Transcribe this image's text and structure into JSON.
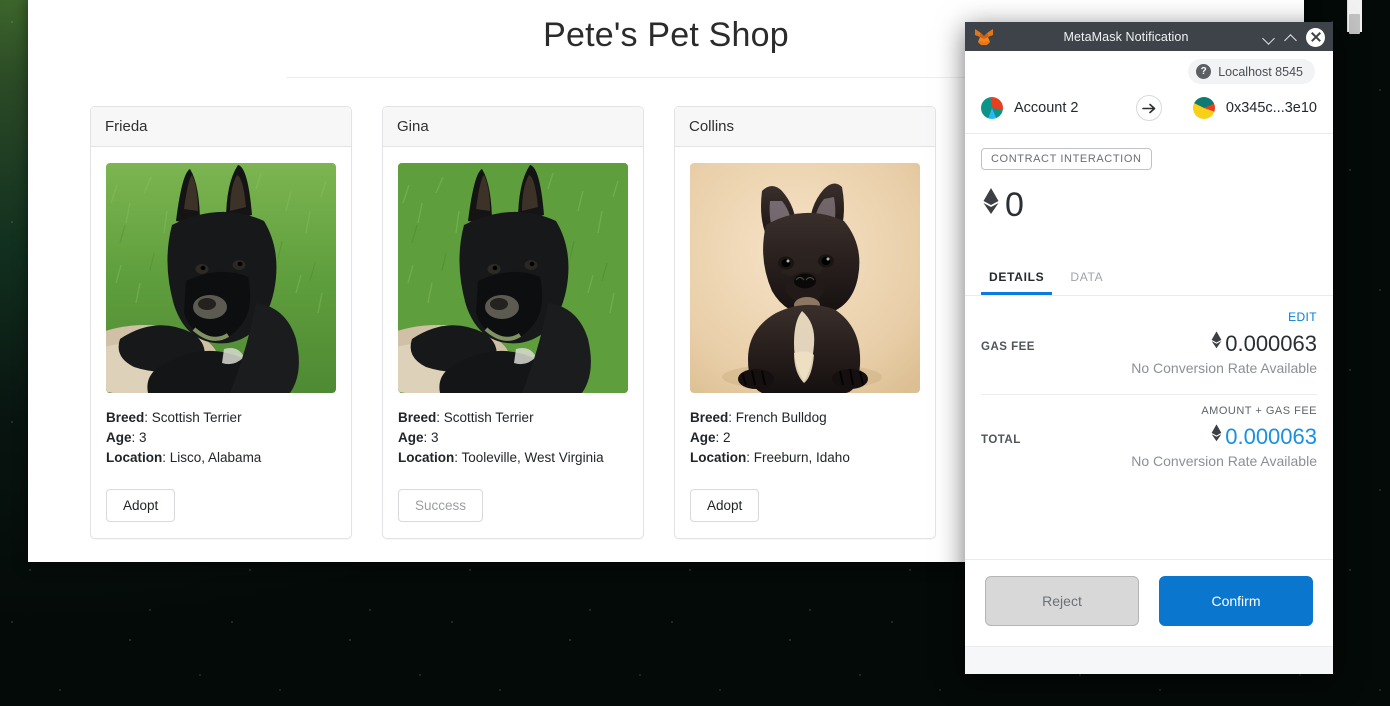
{
  "desktop": {
    "background_color": "#0a1b12"
  },
  "site": {
    "title": "Pete's Pet Shop",
    "pets": [
      {
        "name": "Frieda",
        "breed_label": "Breed",
        "breed": "Scottish Terrier",
        "age_label": "Age",
        "age": "3",
        "location_label": "Location",
        "location": "Lisco, Alabama",
        "button": "Adopt",
        "button_state": "enabled",
        "photo": "scottish-terrier-grass"
      },
      {
        "name": "Gina",
        "breed_label": "Breed",
        "breed": "Scottish Terrier",
        "age_label": "Age",
        "age": "3",
        "location_label": "Location",
        "location": "Tooleville, West Virginia",
        "button": "Success",
        "button_state": "disabled",
        "photo": "scottish-terrier-grass"
      },
      {
        "name": "Collins",
        "breed_label": "Breed",
        "breed": "French Bulldog",
        "age_label": "Age",
        "age": "2",
        "location_label": "Location",
        "location": "Freeburn, Idaho",
        "button": "Adopt",
        "button_state": "enabled",
        "photo": "french-bulldog-tan"
      }
    ]
  },
  "metamask": {
    "window_title": "MetaMask Notification",
    "network": "Localhost 8545",
    "from_account": "Account 2",
    "to_address": "0x345c...3e10",
    "tx_type_pill": "CONTRACT INTERACTION",
    "amount": "0",
    "eth_symbol": "♦",
    "tabs": [
      {
        "label": "DETAILS",
        "active": true
      },
      {
        "label": "DATA",
        "active": false
      }
    ],
    "edit_link": "EDIT",
    "gas_fee_label": "GAS FEE",
    "gas_fee_value": "0.000063",
    "gas_fee_conversion": "No Conversion Rate Available",
    "amount_plus_gas_label": "AMOUNT + GAS FEE",
    "total_label": "TOTAL",
    "total_value": "0.000063",
    "total_conversion": "No Conversion Rate Available",
    "reject_button": "Reject",
    "confirm_button": "Confirm",
    "accent_color": "#037dd6",
    "titlebar_color": "#3d4349"
  }
}
